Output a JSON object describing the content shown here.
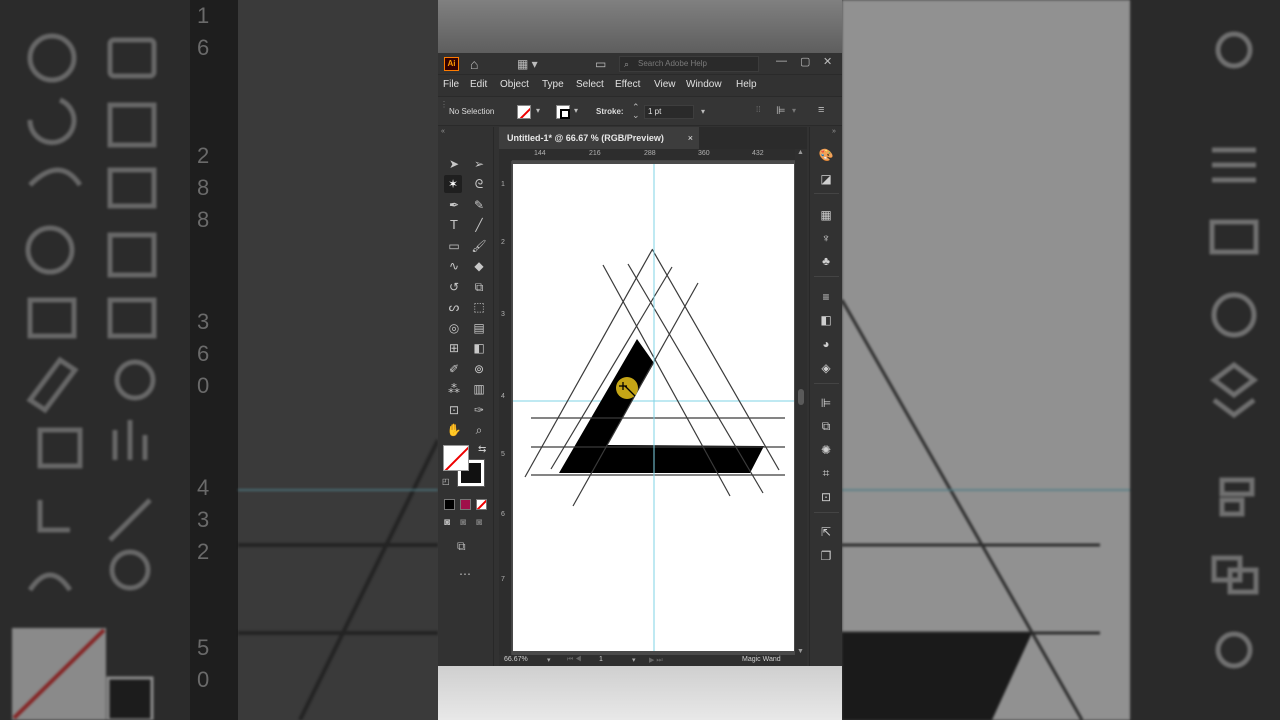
{
  "app": {
    "logo": "Ai",
    "search_placeholder": "Search Adobe Help"
  },
  "menu": {
    "items": [
      "File",
      "Edit",
      "Object",
      "Type",
      "Select",
      "Effect",
      "View",
      "Window",
      "Help"
    ]
  },
  "controlbar": {
    "selection": "No Selection",
    "stroke_label": "Stroke:",
    "stroke_weight": "1 pt"
  },
  "document": {
    "tab_title": "Untitled-1* @ 66.67 % (RGB/Preview)",
    "close": "×"
  },
  "rulers": {
    "top": [
      "144",
      "216",
      "288",
      "360",
      "432"
    ],
    "left": [
      "1",
      "2",
      "3",
      "4",
      "5",
      "6",
      "7"
    ]
  },
  "status": {
    "zoom": "66.67%",
    "artboard_number": "1",
    "current_tool": "Magic Wand"
  },
  "side_left": {
    "ruler_digits": [
      "1",
      "6",
      "2",
      "8",
      "8",
      "3",
      "6",
      "0",
      "4",
      "3",
      "2",
      "5",
      "0"
    ]
  },
  "colors": {
    "panel": "#323232",
    "artboard": "#ffffff",
    "guide": "#7fd3e6",
    "cursor_highlight": "#e8c21a",
    "shape_fill": "#000000"
  }
}
